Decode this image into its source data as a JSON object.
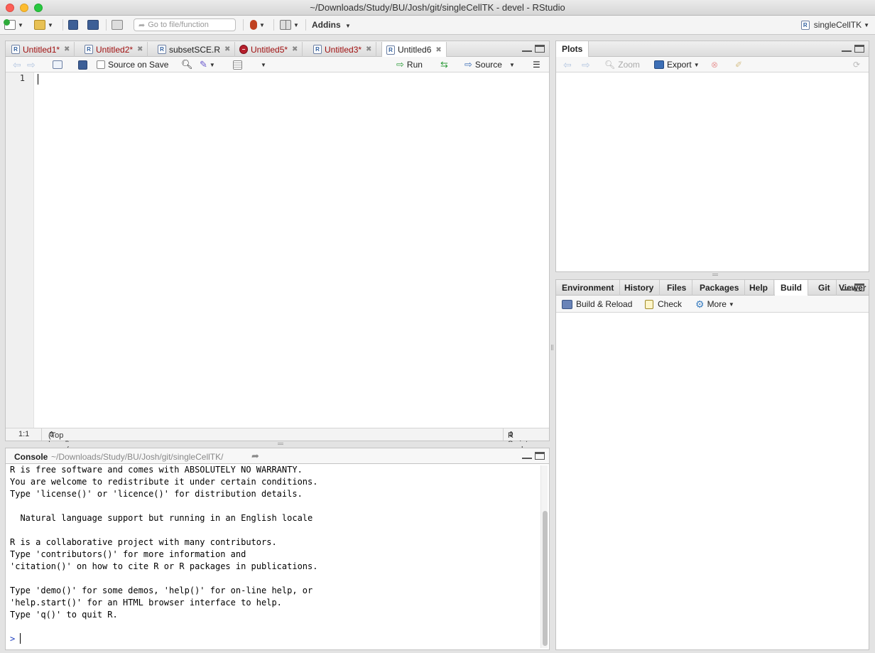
{
  "window": {
    "title": "~/Downloads/Study/BU/Josh/git/singleCellTK - devel - RStudio"
  },
  "toolbar": {
    "goto_placeholder": "Go to file/function",
    "addins_label": "Addins",
    "project_label": "singleCellTK"
  },
  "editor": {
    "tabs": [
      {
        "label": "Untitled1*",
        "modified": true
      },
      {
        "label": "Untitled2*",
        "modified": true
      },
      {
        "label": "subsetSCE.R",
        "modified": false
      },
      {
        "label": "Untitled5*",
        "modified": true
      },
      {
        "label": "Untitled3*",
        "modified": true
      },
      {
        "label": "Untitled6",
        "modified": false,
        "active": true
      }
    ],
    "source_on_save_label": "Source on Save",
    "run_label": "Run",
    "source_label": "Source",
    "line_number": "1",
    "status": {
      "position": "1:1",
      "scope": "(Top Level)",
      "filetype": "R Script"
    }
  },
  "console": {
    "title": "Console",
    "path": "~/Downloads/Study/BU/Josh/git/singleCellTK/",
    "lines": [
      "R is free software and comes with ABSOLUTELY NO WARRANTY.",
      "You are welcome to redistribute it under certain conditions.",
      "Type 'license()' or 'licence()' for distribution details.",
      "",
      "  Natural language support but running in an English locale",
      "",
      "R is a collaborative project with many contributors.",
      "Type 'contributors()' for more information and",
      "'citation()' on how to cite R or R packages in publications.",
      "",
      "Type 'demo()' for some demos, 'help()' for on-line help, or",
      "'help.start()' for an HTML browser interface to help.",
      "Type 'q()' to quit R."
    ],
    "prompt": ">"
  },
  "plots": {
    "tab_label": "Plots",
    "zoom_label": "Zoom",
    "export_label": "Export"
  },
  "lower_right": {
    "tabs": [
      "Environment",
      "History",
      "Files",
      "Packages",
      "Help",
      "Build",
      "Git",
      "Viewer"
    ],
    "active_tab": "Build",
    "build_reload_label": "Build & Reload",
    "check_label": "Check",
    "more_label": "More"
  },
  "icons": {
    "new-file": "new-file-icon",
    "open": "open-folder-icon",
    "save": "save-icon",
    "save-all": "save-all-icon",
    "print": "print-icon",
    "vcs": "vcs-icon",
    "layout": "grid-icon"
  }
}
